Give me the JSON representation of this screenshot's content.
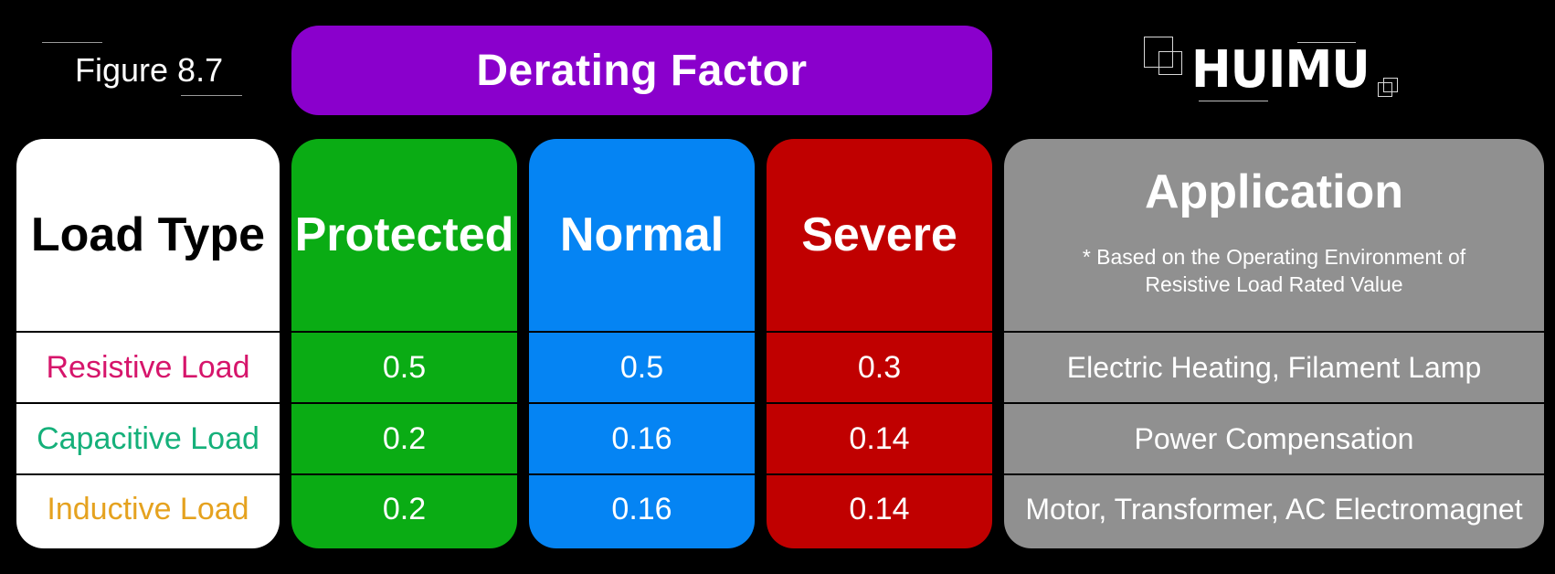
{
  "figure_label": "Figure 8.7",
  "title": "Derating Factor",
  "logo": {
    "text": "HUIMU"
  },
  "colors": {
    "background": "#000000",
    "title": "#8a00cc",
    "load_type": "#ffffff",
    "protected": "#0aac14",
    "normal": "#0584f3",
    "severe": "#c00000",
    "application": "#909090"
  },
  "table": {
    "headers": {
      "load_type": "Load Type",
      "protected": "Protected",
      "normal": "Normal",
      "severe": "Severe",
      "application": "Application",
      "application_note": "* Based on the Operating Environment of Resistive Load Rated Value"
    },
    "rows": [
      {
        "load_type": "Resistive Load",
        "color": "#d6156b",
        "protected": "0.5",
        "normal": "0.5",
        "severe": "0.3",
        "application": "Electric Heating, Filament Lamp"
      },
      {
        "load_type": "Capacitive Load",
        "color": "#15b07a",
        "protected": "0.2",
        "normal": "0.16",
        "severe": "0.14",
        "application": "Power Compensation"
      },
      {
        "load_type": "Inductive Load",
        "color": "#e5a21f",
        "protected": "0.2",
        "normal": "0.16",
        "severe": "0.14",
        "application": "Motor, Transformer, AC Electromagnet"
      }
    ]
  }
}
